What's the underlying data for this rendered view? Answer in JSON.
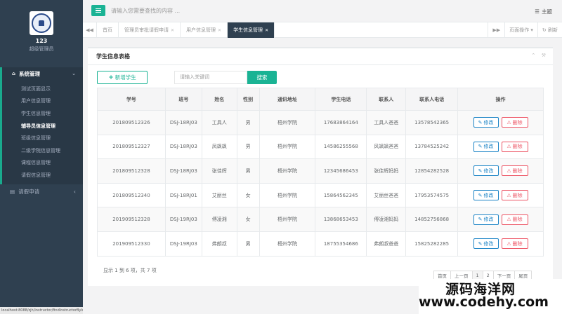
{
  "sidebar": {
    "profile_name": "123",
    "profile_role": "超级管理员",
    "group1": {
      "icon": "home-icon",
      "label": "系统管理",
      "chevron": "⌄"
    },
    "items": [
      {
        "label": "测试页面显示"
      },
      {
        "label": "用户信息管理"
      },
      {
        "label": "学生信息管理"
      },
      {
        "label": "辅导员信息管理"
      },
      {
        "label": "班级信息管理"
      },
      {
        "label": "二级学院信息管理"
      },
      {
        "label": "课程信息管理"
      },
      {
        "label": "请假信息管理"
      }
    ],
    "group2": {
      "icon": "chart-icon",
      "label": "请假申请",
      "chevron": "‹"
    },
    "status_url": "localhost:8088/zjh/instructor/findInstructorById"
  },
  "topbar": {
    "search_placeholder": "请输入您需要查找的内容 ...",
    "theme_label": "主题"
  },
  "tabs": [
    {
      "label": "首页",
      "closable": false
    },
    {
      "label": "管理员审批请假申请",
      "closable": true
    },
    {
      "label": "用户信息管理",
      "closable": true
    },
    {
      "label": "学生信息管理",
      "closable": true,
      "active": true
    }
  ],
  "tab_actions": {
    "page_ops": "页面操作",
    "refresh": "刷新"
  },
  "panel": {
    "title": "学生信息表格",
    "add_label": "新增学生",
    "keyword_placeholder": "请输入关键词",
    "search_label": "搜索",
    "edit_label": "修改",
    "delete_label": "删除"
  },
  "table": {
    "headers": [
      "学号",
      "班号",
      "姓名",
      "性别",
      "通讯地址",
      "学生电话",
      "联系人",
      "联系人电话",
      "操作"
    ],
    "rows": [
      [
        "201809512326",
        "DSJ-18RJ03",
        "工具人",
        "男",
        "梧州学院",
        "17683864164",
        "工具人爸爸",
        "13578542365"
      ],
      [
        "201809512327",
        "DSJ-18RJ03",
        "凤飒飒",
        "男",
        "梧州学院",
        "14586255568",
        "风飒飒爸爸",
        "13784525242"
      ],
      [
        "201809512328",
        "DSJ-18RJ03",
        "张佳辉",
        "男",
        "梧州学院",
        "12345686453",
        "张佳辉妈妈",
        "12854282528"
      ],
      [
        "201809512340",
        "DSJ-18RJ01",
        "艾丽丝",
        "女",
        "梧州学院",
        "15864562345",
        "艾丽丝爸爸",
        "17953574575"
      ],
      [
        "201909512328",
        "DSJ-19RJ03",
        "傅凌湘",
        "女",
        "梧州学院",
        "13868653453",
        "傅凌湘妈妈",
        "14852756868"
      ],
      [
        "201909512330",
        "DSJ-19RJ03",
        "弗朗叔",
        "男",
        "梧州学院",
        "18755354686",
        "弗朗叔爸爸",
        "15825282285"
      ]
    ]
  },
  "summary": "显示 1 到 6 项，共 7 项",
  "pagination": [
    "首页",
    "上一页",
    "1",
    "2",
    "下一页",
    "尾页"
  ],
  "watermark": {
    "line1": "源码海洋网",
    "line2": "www.codehy.com"
  },
  "colors": {
    "accent": "#1ab394",
    "sidebar": "#2f4050",
    "edit": "#1c84c6",
    "delete": "#ed5565"
  }
}
